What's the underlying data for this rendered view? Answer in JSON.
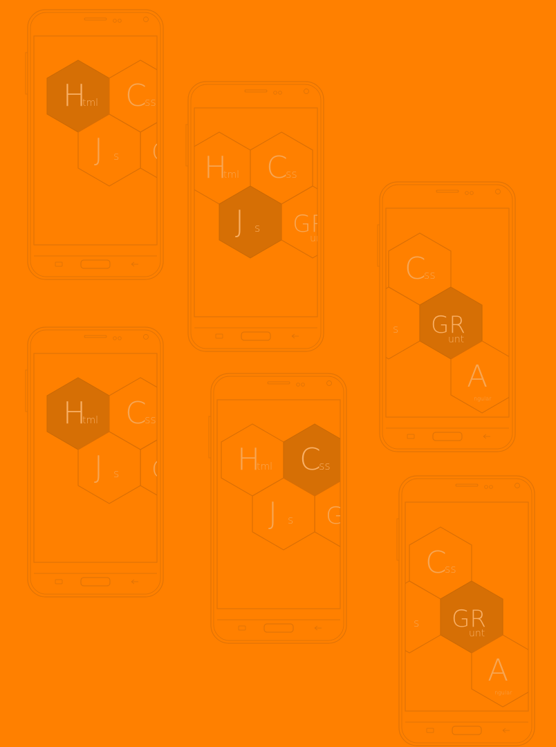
{
  "colors": {
    "background": "#ff8000",
    "outline": "#e07306",
    "tile_fill": "#d66f05",
    "tile_text": "#f7a654"
  },
  "tiles": {
    "html": {
      "big": "H",
      "small": "tml"
    },
    "css": {
      "big": "C",
      "small": "ss"
    },
    "js": {
      "big": "J",
      "small": "s"
    },
    "grunt": {
      "big": "GR",
      "small": "unt"
    },
    "angular": {
      "big": "A",
      "small": "ngular"
    }
  },
  "phones": [
    {
      "id": "phone-1",
      "highlighted": "html",
      "tiles": [
        {
          "key": "html",
          "col": 0,
          "row": 0
        },
        {
          "key": "css",
          "col": 1,
          "row": 0
        },
        {
          "key": "js",
          "col": 0.5,
          "row": 1
        },
        {
          "key": "grunt",
          "col": 1.5,
          "row": 1
        }
      ]
    },
    {
      "id": "phone-2",
      "highlighted": "js",
      "tiles": [
        {
          "key": "html",
          "col": 0,
          "row": 0
        },
        {
          "key": "css",
          "col": 1,
          "row": 0
        },
        {
          "key": "js",
          "col": 0.5,
          "row": 1
        },
        {
          "key": "grunt",
          "col": 1.5,
          "row": 1
        }
      ]
    },
    {
      "id": "phone-3",
      "highlighted": "grunt",
      "tiles": [
        {
          "key": "css",
          "col": 0,
          "row": 0
        },
        {
          "key": "js",
          "col": -0.5,
          "row": 1
        },
        {
          "key": "grunt",
          "col": 0.5,
          "row": 1
        },
        {
          "key": "angular",
          "col": 1,
          "row": 2
        }
      ]
    },
    {
      "id": "phone-4",
      "highlighted": "html",
      "tiles": [
        {
          "key": "html",
          "col": 0,
          "row": 0
        },
        {
          "key": "css",
          "col": 1,
          "row": 0
        },
        {
          "key": "js",
          "col": 0.5,
          "row": 1
        },
        {
          "key": "grunt",
          "col": 1.5,
          "row": 1
        }
      ]
    },
    {
      "id": "phone-5",
      "highlighted": "css",
      "tiles": [
        {
          "key": "html",
          "col": 0,
          "row": 0
        },
        {
          "key": "css",
          "col": 1,
          "row": 0
        },
        {
          "key": "js",
          "col": 0.5,
          "row": 1
        },
        {
          "key": "grunt",
          "col": 1.5,
          "row": 1
        }
      ]
    },
    {
      "id": "phone-6",
      "highlighted": "grunt",
      "tiles": [
        {
          "key": "css",
          "col": 0,
          "row": 0
        },
        {
          "key": "js",
          "col": -0.5,
          "row": 1
        },
        {
          "key": "grunt",
          "col": 0.5,
          "row": 1
        },
        {
          "key": "angular",
          "col": 1,
          "row": 2
        }
      ]
    }
  ]
}
